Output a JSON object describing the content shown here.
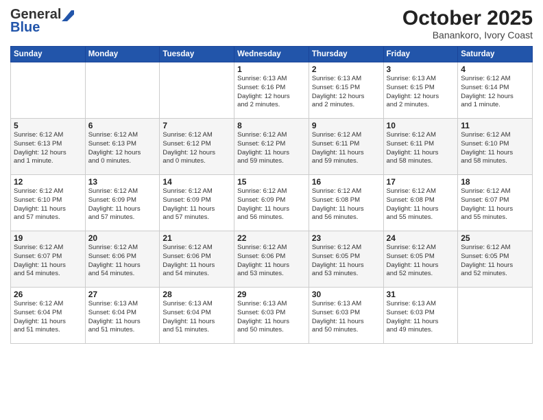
{
  "header": {
    "logo_general": "General",
    "logo_blue": "Blue",
    "month": "October 2025",
    "location": "Banankoro, Ivory Coast"
  },
  "days_of_week": [
    "Sunday",
    "Monday",
    "Tuesday",
    "Wednesday",
    "Thursday",
    "Friday",
    "Saturday"
  ],
  "weeks": [
    [
      {
        "day": "",
        "info": ""
      },
      {
        "day": "",
        "info": ""
      },
      {
        "day": "",
        "info": ""
      },
      {
        "day": "1",
        "info": "Sunrise: 6:13 AM\nSunset: 6:16 PM\nDaylight: 12 hours\nand 2 minutes."
      },
      {
        "day": "2",
        "info": "Sunrise: 6:13 AM\nSunset: 6:15 PM\nDaylight: 12 hours\nand 2 minutes."
      },
      {
        "day": "3",
        "info": "Sunrise: 6:13 AM\nSunset: 6:15 PM\nDaylight: 12 hours\nand 2 minutes."
      },
      {
        "day": "4",
        "info": "Sunrise: 6:12 AM\nSunset: 6:14 PM\nDaylight: 12 hours\nand 1 minute."
      }
    ],
    [
      {
        "day": "5",
        "info": "Sunrise: 6:12 AM\nSunset: 6:13 PM\nDaylight: 12 hours\nand 1 minute."
      },
      {
        "day": "6",
        "info": "Sunrise: 6:12 AM\nSunset: 6:13 PM\nDaylight: 12 hours\nand 0 minutes."
      },
      {
        "day": "7",
        "info": "Sunrise: 6:12 AM\nSunset: 6:12 PM\nDaylight: 12 hours\nand 0 minutes."
      },
      {
        "day": "8",
        "info": "Sunrise: 6:12 AM\nSunset: 6:12 PM\nDaylight: 11 hours\nand 59 minutes."
      },
      {
        "day": "9",
        "info": "Sunrise: 6:12 AM\nSunset: 6:11 PM\nDaylight: 11 hours\nand 59 minutes."
      },
      {
        "day": "10",
        "info": "Sunrise: 6:12 AM\nSunset: 6:11 PM\nDaylight: 11 hours\nand 58 minutes."
      },
      {
        "day": "11",
        "info": "Sunrise: 6:12 AM\nSunset: 6:10 PM\nDaylight: 11 hours\nand 58 minutes."
      }
    ],
    [
      {
        "day": "12",
        "info": "Sunrise: 6:12 AM\nSunset: 6:10 PM\nDaylight: 11 hours\nand 57 minutes."
      },
      {
        "day": "13",
        "info": "Sunrise: 6:12 AM\nSunset: 6:09 PM\nDaylight: 11 hours\nand 57 minutes."
      },
      {
        "day": "14",
        "info": "Sunrise: 6:12 AM\nSunset: 6:09 PM\nDaylight: 11 hours\nand 57 minutes."
      },
      {
        "day": "15",
        "info": "Sunrise: 6:12 AM\nSunset: 6:09 PM\nDaylight: 11 hours\nand 56 minutes."
      },
      {
        "day": "16",
        "info": "Sunrise: 6:12 AM\nSunset: 6:08 PM\nDaylight: 11 hours\nand 56 minutes."
      },
      {
        "day": "17",
        "info": "Sunrise: 6:12 AM\nSunset: 6:08 PM\nDaylight: 11 hours\nand 55 minutes."
      },
      {
        "day": "18",
        "info": "Sunrise: 6:12 AM\nSunset: 6:07 PM\nDaylight: 11 hours\nand 55 minutes."
      }
    ],
    [
      {
        "day": "19",
        "info": "Sunrise: 6:12 AM\nSunset: 6:07 PM\nDaylight: 11 hours\nand 54 minutes."
      },
      {
        "day": "20",
        "info": "Sunrise: 6:12 AM\nSunset: 6:06 PM\nDaylight: 11 hours\nand 54 minutes."
      },
      {
        "day": "21",
        "info": "Sunrise: 6:12 AM\nSunset: 6:06 PM\nDaylight: 11 hours\nand 54 minutes."
      },
      {
        "day": "22",
        "info": "Sunrise: 6:12 AM\nSunset: 6:06 PM\nDaylight: 11 hours\nand 53 minutes."
      },
      {
        "day": "23",
        "info": "Sunrise: 6:12 AM\nSunset: 6:05 PM\nDaylight: 11 hours\nand 53 minutes."
      },
      {
        "day": "24",
        "info": "Sunrise: 6:12 AM\nSunset: 6:05 PM\nDaylight: 11 hours\nand 52 minutes."
      },
      {
        "day": "25",
        "info": "Sunrise: 6:12 AM\nSunset: 6:05 PM\nDaylight: 11 hours\nand 52 minutes."
      }
    ],
    [
      {
        "day": "26",
        "info": "Sunrise: 6:12 AM\nSunset: 6:04 PM\nDaylight: 11 hours\nand 51 minutes."
      },
      {
        "day": "27",
        "info": "Sunrise: 6:13 AM\nSunset: 6:04 PM\nDaylight: 11 hours\nand 51 minutes."
      },
      {
        "day": "28",
        "info": "Sunrise: 6:13 AM\nSunset: 6:04 PM\nDaylight: 11 hours\nand 51 minutes."
      },
      {
        "day": "29",
        "info": "Sunrise: 6:13 AM\nSunset: 6:03 PM\nDaylight: 11 hours\nand 50 minutes."
      },
      {
        "day": "30",
        "info": "Sunrise: 6:13 AM\nSunset: 6:03 PM\nDaylight: 11 hours\nand 50 minutes."
      },
      {
        "day": "31",
        "info": "Sunrise: 6:13 AM\nSunset: 6:03 PM\nDaylight: 11 hours\nand 49 minutes."
      },
      {
        "day": "",
        "info": ""
      }
    ]
  ]
}
